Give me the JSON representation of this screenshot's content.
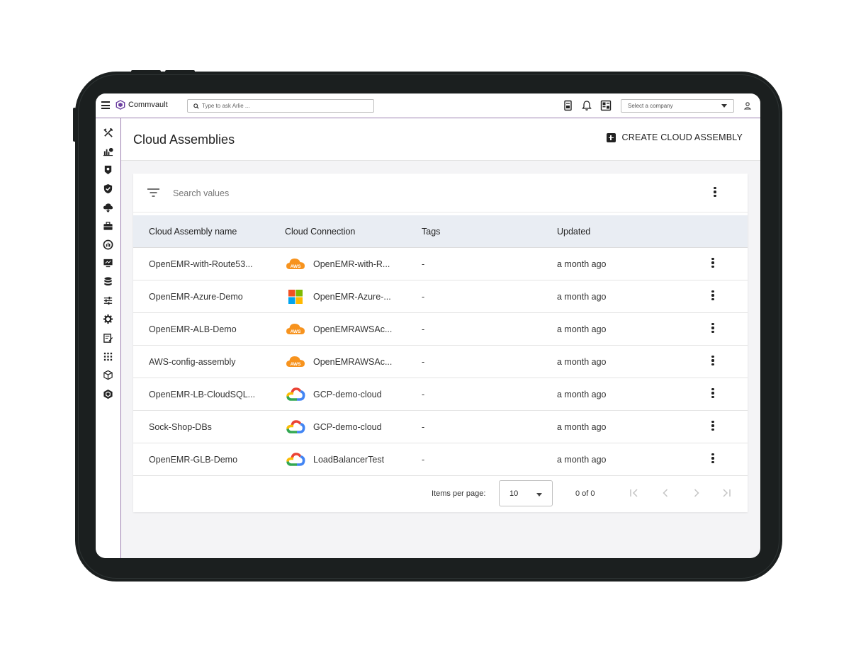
{
  "topbar": {
    "brand": "Commvault",
    "ask_placeholder": "Type to ask Arlie ...",
    "company_select": "Select a company"
  },
  "page": {
    "title": "Cloud Assemblies",
    "create_label": "CREATE CLOUD ASSEMBLY"
  },
  "search": {
    "placeholder": "Search values"
  },
  "table": {
    "columns": [
      "Cloud Assembly name",
      "Cloud Connection",
      "Tags",
      "Updated"
    ],
    "rows": [
      {
        "name": "OpenEMR-with-Route53...",
        "connection": "OpenEMR-with-R...",
        "provider": "aws",
        "tags": "-",
        "updated": "a month ago"
      },
      {
        "name": "OpenEMR-Azure-Demo",
        "connection": "OpenEMR-Azure-...",
        "provider": "azure",
        "tags": "-",
        "updated": "a month ago"
      },
      {
        "name": "OpenEMR-ALB-Demo",
        "connection": "OpenEMRAWSAc...",
        "provider": "aws",
        "tags": "-",
        "updated": "a month ago"
      },
      {
        "name": "AWS-config-assembly",
        "connection": "OpenEMRAWSAc...",
        "provider": "aws",
        "tags": "-",
        "updated": "a month ago"
      },
      {
        "name": "OpenEMR-LB-CloudSQL...",
        "connection": "GCP-demo-cloud",
        "provider": "gcp",
        "tags": "-",
        "updated": "a month ago"
      },
      {
        "name": "Sock-Shop-DBs",
        "connection": "GCP-demo-cloud",
        "provider": "gcp",
        "tags": "-",
        "updated": "a month ago"
      },
      {
        "name": "OpenEMR-GLB-Demo",
        "connection": "LoadBalancerTest",
        "provider": "gcp",
        "tags": "-",
        "updated": "a month ago"
      }
    ]
  },
  "pagination": {
    "items_per_page_label": "Items per page:",
    "items_per_page": "10",
    "range": "0 of 0"
  },
  "aws_badge": "AWS",
  "colors": {
    "accent": "#9b7fb0",
    "header_bg": "#e9edf3",
    "aws": "#f7931e"
  }
}
